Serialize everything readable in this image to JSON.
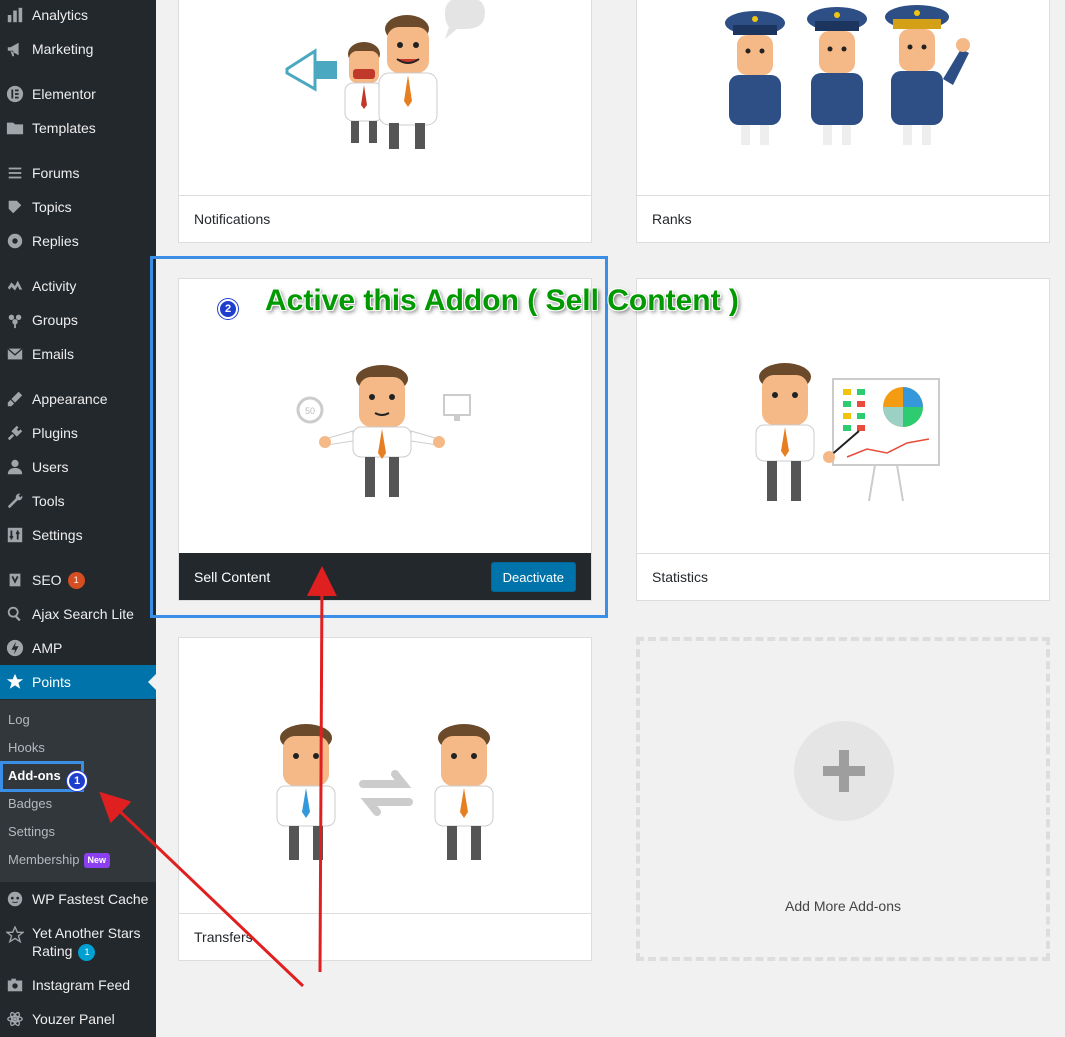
{
  "sidebar": {
    "items": [
      {
        "label": "Analytics",
        "icon": "bar-chart-icon"
      },
      {
        "label": "Marketing",
        "icon": "megaphone-icon"
      },
      {
        "label": "Elementor",
        "icon": "elementor-icon"
      },
      {
        "label": "Templates",
        "icon": "folder-icon"
      },
      {
        "label": "Forums",
        "icon": "forums-icon"
      },
      {
        "label": "Topics",
        "icon": "topics-icon"
      },
      {
        "label": "Replies",
        "icon": "replies-icon"
      },
      {
        "label": "Activity",
        "icon": "activity-icon"
      },
      {
        "label": "Groups",
        "icon": "groups-icon"
      },
      {
        "label": "Emails",
        "icon": "email-icon"
      },
      {
        "label": "Appearance",
        "icon": "brush-icon"
      },
      {
        "label": "Plugins",
        "icon": "plug-icon"
      },
      {
        "label": "Users",
        "icon": "user-icon"
      },
      {
        "label": "Tools",
        "icon": "wrench-icon"
      },
      {
        "label": "Settings",
        "icon": "settings-icon"
      },
      {
        "label": "SEO",
        "icon": "yoast-icon",
        "badge": "1"
      },
      {
        "label": "Ajax Search Lite",
        "icon": "search-icon"
      },
      {
        "label": "AMP",
        "icon": "amp-icon"
      },
      {
        "label": "Points",
        "icon": "star-icon"
      },
      {
        "label": "WP Fastest Cache",
        "icon": "cheetah-icon"
      },
      {
        "label": "Yet Another Stars",
        "label2": "Rating",
        "icon": "star-outline-icon",
        "badge": "1"
      },
      {
        "label": "Instagram Feed",
        "icon": "camera-icon"
      },
      {
        "label": "Youzer Panel",
        "icon": "atom-icon"
      }
    ],
    "submenu": [
      {
        "label": "Log"
      },
      {
        "label": "Hooks"
      },
      {
        "label": "Add-ons"
      },
      {
        "label": "Badges"
      },
      {
        "label": "Settings"
      },
      {
        "label": "Membership",
        "badge": "New"
      }
    ]
  },
  "addons": {
    "notifications": {
      "title": "Notifications"
    },
    "ranks": {
      "title": "Ranks"
    },
    "sell_content": {
      "title": "Sell Content",
      "button": "Deactivate"
    },
    "statistics": {
      "title": "Statistics"
    },
    "transfers": {
      "title": "Transfers"
    },
    "add_more": {
      "title": "Add More Add-ons"
    }
  },
  "annotations": {
    "step1": "1",
    "step2": "2",
    "headline": "Active this Addon ( Sell Content )"
  },
  "colors": {
    "sidebar_bg": "#23282d",
    "active_menu": "#0073aa",
    "annotation_box": "#3a8ee6",
    "annotation_text": "#009900",
    "arrow": "#e02020"
  }
}
